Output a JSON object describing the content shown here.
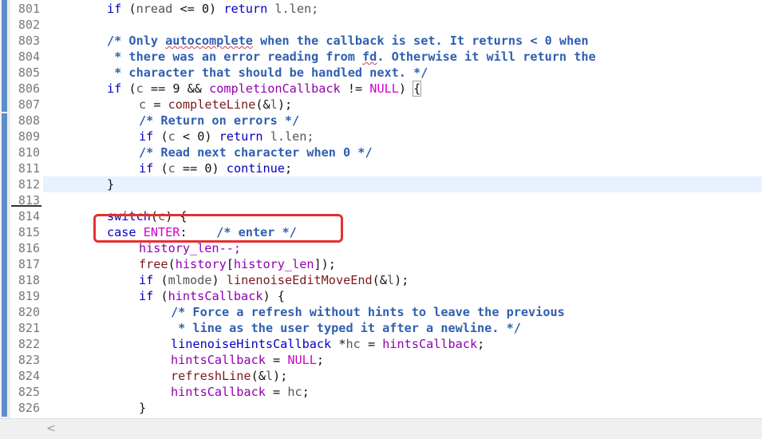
{
  "editor": {
    "current_line": "812",
    "lines": [
      {
        "n": "801",
        "code": "if (nread <= 0) return l.len;"
      },
      {
        "n": "802",
        "code": ""
      },
      {
        "n": "803",
        "code": "/* Only autocomplete when the callback is set. It returns < 0 when"
      },
      {
        "n": "804",
        "code": " * there was an error reading from fd. Otherwise it will return the"
      },
      {
        "n": "805",
        "code": " * character that should be handled next. */"
      },
      {
        "n": "806",
        "code": "if (c == 9 && completionCallback != NULL) {"
      },
      {
        "n": "807",
        "code": "c = completeLine(&l);"
      },
      {
        "n": "808",
        "code": "/* Return on errors */"
      },
      {
        "n": "809",
        "code": "if (c < 0) return l.len;"
      },
      {
        "n": "810",
        "code": "/* Read next character when 0 */"
      },
      {
        "n": "811",
        "code": "if (c == 0) continue;"
      },
      {
        "n": "812",
        "code": "}"
      },
      {
        "n": "813",
        "code": ""
      },
      {
        "n": "814",
        "code": "switch(c) {"
      },
      {
        "n": "815",
        "code": "case ENTER:    /* enter */"
      },
      {
        "n": "816",
        "code": "history_len--;"
      },
      {
        "n": "817",
        "code": "free(history[history_len]);"
      },
      {
        "n": "818",
        "code": "if (mlmode) linenoiseEditMoveEnd(&l);"
      },
      {
        "n": "819",
        "code": "if (hintsCallback) {"
      },
      {
        "n": "820",
        "code": "/* Force a refresh without hints to leave the previous"
      },
      {
        "n": "821",
        "code": " * line as the user typed it after a newline. */"
      },
      {
        "n": "822",
        "code": "linenoiseHintsCallback *hc = hintsCallback;"
      },
      {
        "n": "823",
        "code": "hintsCallback = NULL;"
      },
      {
        "n": "824",
        "code": "refreshLine(&l);"
      },
      {
        "n": "825",
        "code": "hintsCallback = hc;"
      },
      {
        "n": "826",
        "code": "}"
      }
    ]
  },
  "annotation": {
    "color": "#e53030",
    "target_line": "815"
  },
  "scrollbar": {
    "left_arrow": "<"
  }
}
